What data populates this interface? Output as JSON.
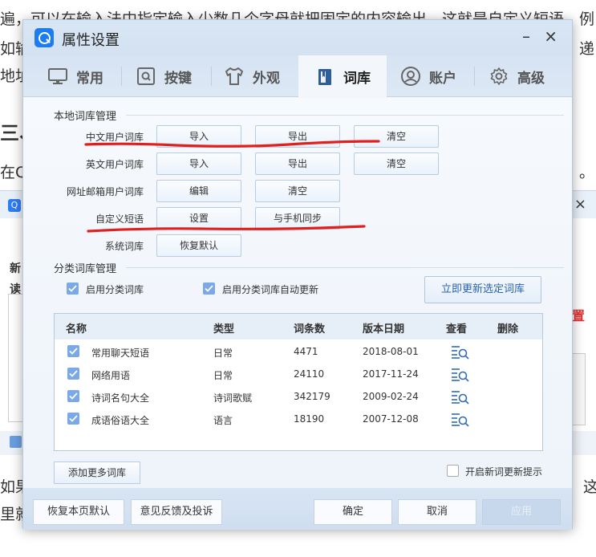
{
  "background": {
    "line1": "遍，可以在输入法中指定输入少数几个字母就把固定的内容输出，这就是自定义短语，例",
    "line2_left": "如输",
    "line2_right": "递",
    "line3_left": "地址",
    "heading_left": "三、",
    "line4_left": "在Q",
    "line4_right": "。",
    "side_new": "新",
    "side_read": "读",
    "side_red": "置",
    "line5_left": "如果",
    "line5_right": "这",
    "line6_left": "里就"
  },
  "dialog": {
    "title": "属性设置",
    "minimize": "–",
    "close": "×",
    "tabs": [
      {
        "label": "常用",
        "icon": "monitor-icon"
      },
      {
        "label": "按键",
        "icon": "keyboard-key-icon"
      },
      {
        "label": "外观",
        "icon": "tshirt-icon"
      },
      {
        "label": "词库",
        "icon": "book-icon"
      },
      {
        "label": "账户",
        "icon": "user-icon"
      },
      {
        "label": "高级",
        "icon": "gear-icon"
      }
    ],
    "active_tab": "词库"
  },
  "local_lexicon": {
    "title": "本地词库管理",
    "rows": [
      {
        "label": "中文用户词库",
        "buttons": [
          "导入",
          "导出",
          "清空"
        ]
      },
      {
        "label": "英文用户词库",
        "buttons": [
          "导入",
          "导出",
          "清空"
        ]
      },
      {
        "label": "网址邮箱用户词库",
        "buttons": [
          "编辑",
          "清空"
        ]
      },
      {
        "label": "自定义短语",
        "buttons": [
          "设置",
          "与手机同步"
        ]
      },
      {
        "label": "系统词库",
        "buttons": [
          "恢复默认"
        ]
      }
    ]
  },
  "category_lexicon": {
    "title": "分类词库管理",
    "enable_label": "启用分类词库",
    "enable_checked": true,
    "auto_update_label": "启用分类词库自动更新",
    "auto_update_checked": true,
    "update_now_label": "立即更新选定词库",
    "table": {
      "headers": [
        "名称",
        "类型",
        "词条数",
        "版本日期",
        "查看",
        "删除"
      ],
      "rows": [
        {
          "checked": true,
          "name": "常用聊天短语",
          "type": "日常",
          "count": "4471",
          "date": "2018-08-01"
        },
        {
          "checked": true,
          "name": "网络用语",
          "type": "日常",
          "count": "24110",
          "date": "2017-11-24"
        },
        {
          "checked": true,
          "name": "诗词名句大全",
          "type": "诗词歌赋",
          "count": "342179",
          "date": "2009-02-24"
        },
        {
          "checked": true,
          "name": "成语俗语大全",
          "type": "语言",
          "count": "18190",
          "date": "2007-12-08"
        }
      ]
    },
    "add_more_label": "添加更多词库",
    "new_lexicon_tip_label": "开启新词更新提示",
    "new_lexicon_tip_checked": false
  },
  "footer": {
    "restore_label": "恢复本页默认",
    "feedback_label": "意见反馈及投诉",
    "ok_label": "确定",
    "cancel_label": "取消",
    "apply_label": "应用"
  },
  "colors": {
    "accent": "#2f7df6",
    "check_blue": "#7ba9e6",
    "annotation_red": "#e0201f"
  }
}
